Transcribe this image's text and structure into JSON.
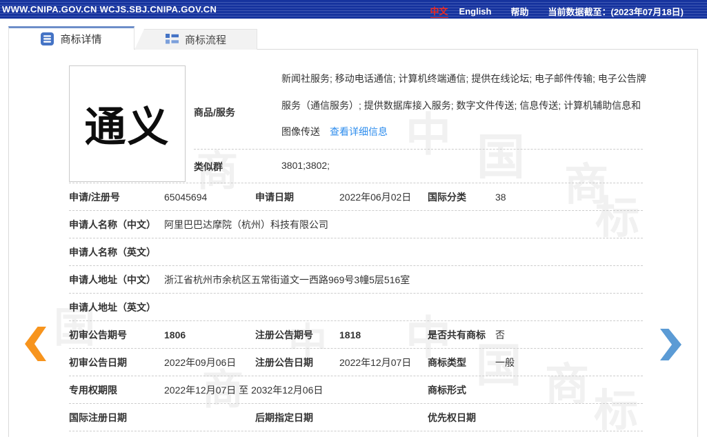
{
  "topbar": {
    "domains": "WWW.CNIPA.GOV.CN WCJS.SBJ.CNIPA.GOV.CN",
    "lang_zh": "中文",
    "lang_en": "English",
    "help": "帮助",
    "data_until": "当前数据截至：(2023年07月18日)"
  },
  "tabs": [
    {
      "label": "商标详情",
      "active": true
    },
    {
      "label": "商标流程",
      "active": false
    }
  ],
  "trademark": {
    "image_text": "通义"
  },
  "goods": {
    "label": "商品/服务",
    "value": "新闻社服务; 移动电话通信; 计算机终端通信; 提供在线论坛; 电子邮件传输; 电子公告牌服务（通信服务）; 提供数据库接入服务; 数字文件传送; 信息传送; 计算机辅助信息和图像传送",
    "link": "查看详细信息"
  },
  "similar_group": {
    "label": "类似群",
    "value": "3801;3802;"
  },
  "table": {
    "rows": [
      {
        "cells": [
          {
            "label": "申请/注册号",
            "value": "65045694"
          },
          {
            "label": "申请日期",
            "value": "2022年06月02日"
          },
          {
            "label": "国际分类",
            "value": "38"
          }
        ]
      },
      {
        "cells": [
          {
            "label": "申请人名称（中文）",
            "value": "阿里巴巴达摩院（杭州）科技有限公司"
          }
        ]
      },
      {
        "cells": [
          {
            "label": "申请人名称（英文）",
            "value": ""
          }
        ]
      },
      {
        "cells": [
          {
            "label": "申请人地址（中文）",
            "value": "浙江省杭州市余杭区五常街道文一西路969号3幢5层516室"
          }
        ]
      },
      {
        "cells": [
          {
            "label": "申请人地址（英文）",
            "value": ""
          }
        ]
      },
      {
        "cells": [
          {
            "label": "初审公告期号",
            "value": "1806"
          },
          {
            "label": "注册公告期号",
            "value": "1818"
          },
          {
            "label": "是否共有商标",
            "value": "否"
          }
        ]
      },
      {
        "cells": [
          {
            "label": "初审公告日期",
            "value": "2022年09月06日"
          },
          {
            "label": "注册公告日期",
            "value": "2022年12月07日"
          },
          {
            "label": "商标类型",
            "value": "一般"
          }
        ]
      },
      {
        "cells": [
          {
            "label": "专用权期限",
            "value": "2022年12月07日 至 2032年12月06日"
          },
          {
            "label": "商标形式",
            "value": ""
          }
        ]
      },
      {
        "cells": [
          {
            "label": "国际注册日期",
            "value": ""
          },
          {
            "label": "后期指定日期",
            "value": ""
          },
          {
            "label": "优先权日期",
            "value": ""
          }
        ]
      }
    ]
  },
  "watermark": {
    "chars": [
      "中",
      "国",
      "商",
      "标"
    ]
  },
  "colors": {
    "topbar_blue": "#16339e",
    "tab_icon_blue": "#4473c5",
    "link_blue": "#2e8ded",
    "arrow_left_orange": "#f7941d",
    "arrow_right_blue": "#5b9bd5",
    "lang_red": "#ef2a1e"
  }
}
